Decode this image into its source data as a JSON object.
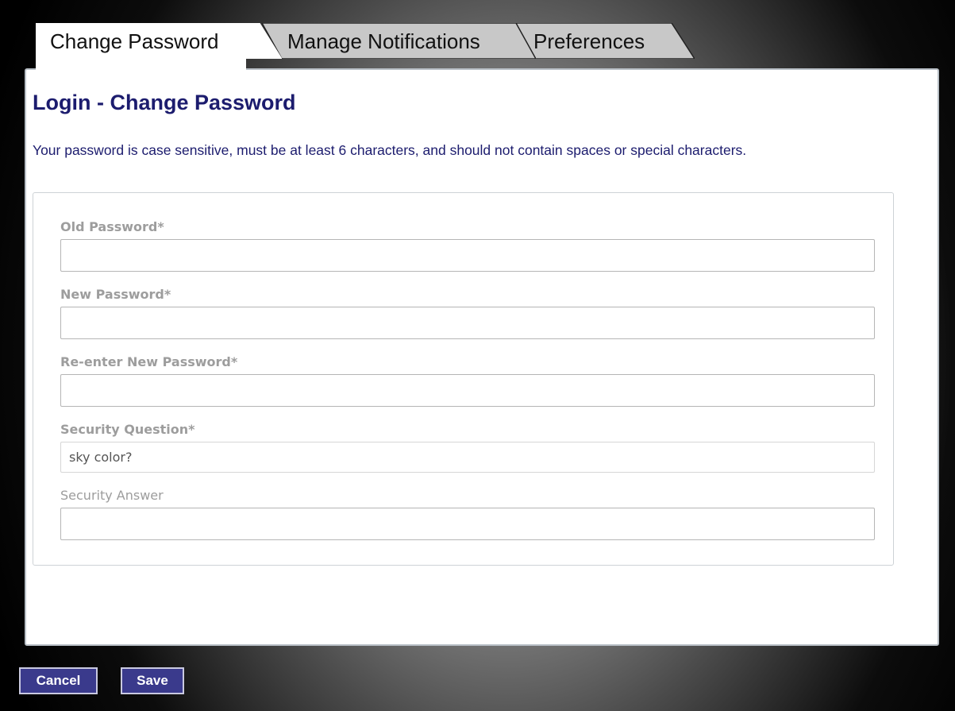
{
  "tabs": [
    {
      "label": "Change Password",
      "active": true
    },
    {
      "label": "Manage Notifications",
      "active": false
    },
    {
      "label": "Preferences",
      "active": false
    }
  ],
  "page": {
    "title": "Login - Change Password",
    "instructions": "Your password is case sensitive, must be at least 6 characters, and should not contain spaces or special characters."
  },
  "form": {
    "old_password": {
      "label": "Old Password*",
      "value": ""
    },
    "new_password": {
      "label": "New Password*",
      "value": ""
    },
    "reenter_password": {
      "label": "Re-enter New Password*",
      "value": ""
    },
    "security_question": {
      "label": "Security Question*",
      "value": "sky color?"
    },
    "security_answer": {
      "label": "Security Answer",
      "value": ""
    }
  },
  "buttons": {
    "cancel": "Cancel",
    "save": "Save"
  },
  "colors": {
    "title": "#1c1c6e",
    "button": "#3a3a8c",
    "label": "#9d9d9d",
    "tab_inactive": "#c8c8c8"
  }
}
